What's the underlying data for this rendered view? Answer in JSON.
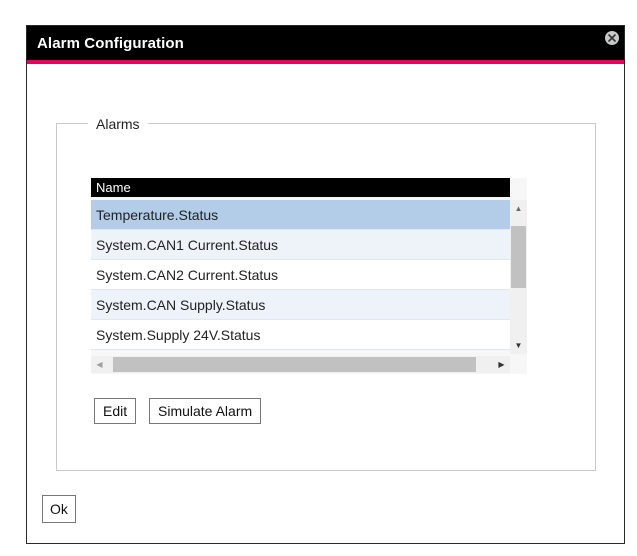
{
  "dialog": {
    "title": "Alarm Configuration",
    "close_icon": "close-icon"
  },
  "alarms_group": {
    "legend": "Alarms",
    "grid": {
      "column_header": "Name",
      "rows": [
        {
          "name": "Temperature.Status",
          "selected": true
        },
        {
          "name": "System.CAN1 Current.Status",
          "selected": false
        },
        {
          "name": "System.CAN2 Current.Status",
          "selected": false
        },
        {
          "name": "System.CAN Supply.Status",
          "selected": false
        },
        {
          "name": "System.Supply 24V.Status",
          "selected": false
        }
      ]
    },
    "edit_label": "Edit",
    "simulate_label": "Simulate Alarm"
  },
  "footer": {
    "ok_label": "Ok"
  },
  "colors": {
    "accent": "#e2065e",
    "titlebar": "#000000",
    "selected_row": "#b3cce7"
  }
}
